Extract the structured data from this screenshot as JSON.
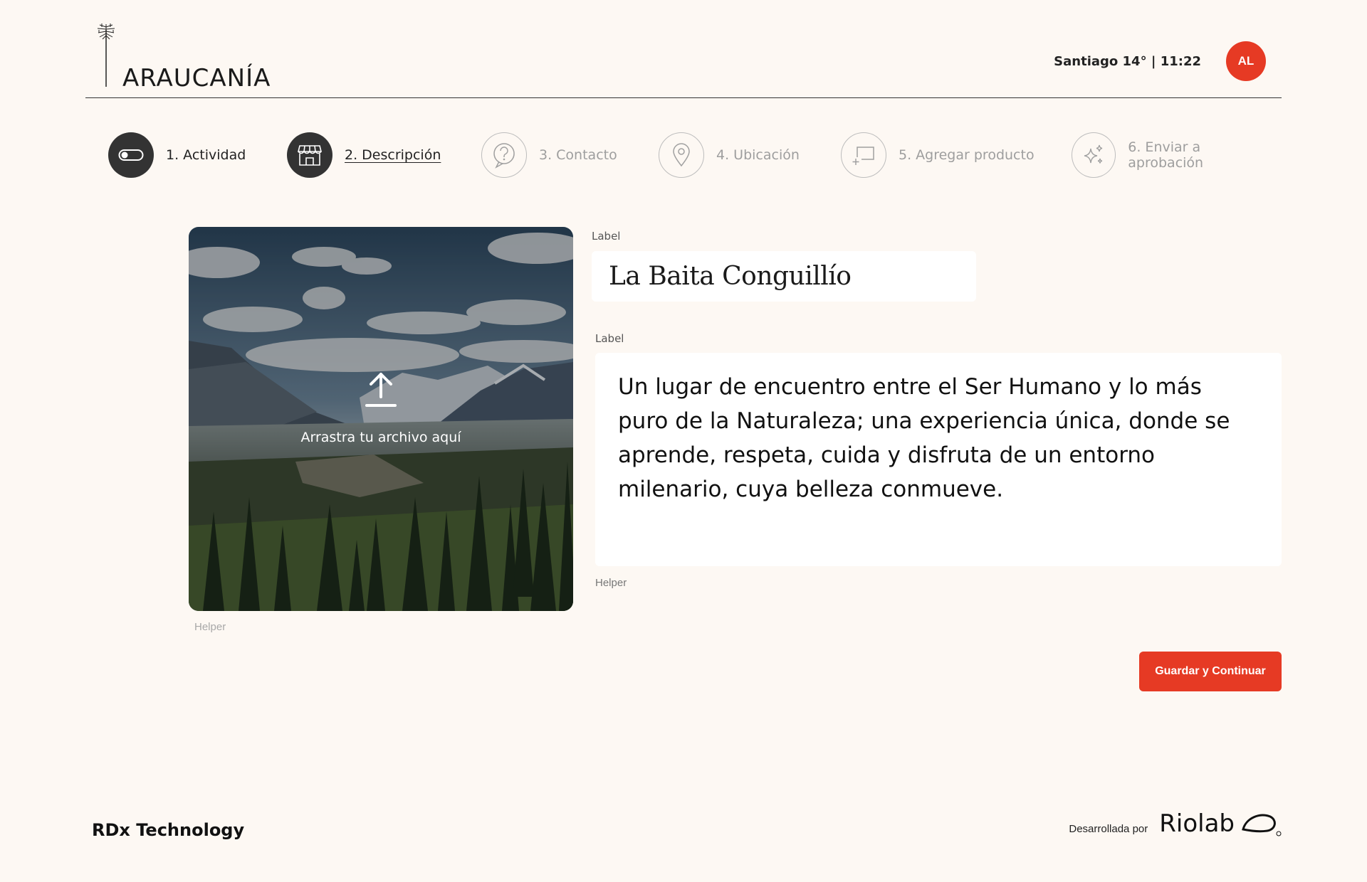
{
  "header": {
    "logo_text": "ARAUCANÍA",
    "weather": "Santiago 14° | 11:22",
    "avatar_initials": "AL"
  },
  "steps": [
    {
      "label": "1. Actividad",
      "state": "done",
      "icon": "toggle-icon"
    },
    {
      "label": "2. Descripción",
      "state": "active",
      "icon": "store-icon"
    },
    {
      "label": "3. Contacto",
      "state": "todo",
      "icon": "question-icon"
    },
    {
      "label": "4. Ubicación",
      "state": "todo",
      "icon": "location-pin-icon"
    },
    {
      "label": "5. Agregar producto",
      "state": "todo",
      "icon": "add-product-icon"
    },
    {
      "label": "6. Enviar a aprobación",
      "state": "todo",
      "icon": "sparkles-icon"
    }
  ],
  "upload": {
    "text": "Arrastra tu archivo aquí",
    "helper": "Helper",
    "icon": "upload-icon"
  },
  "title_field": {
    "label": "Label",
    "value": "La Baita Conguillío"
  },
  "description_field": {
    "label": "Label",
    "value": "Un lugar de encuentro entre el Ser Humano y lo más puro de la Naturaleza; una experiencia única, donde se aprende, respeta, cuida y disfruta de un entorno milenario, cuya belleza conmueve.",
    "helper": "Helper"
  },
  "actions": {
    "save_label": "Guardar y Continuar"
  },
  "footer": {
    "company": "RDx Technology",
    "developed_by": "Desarrollada por",
    "brand": "Riolab"
  },
  "colors": {
    "accent": "#e63a24",
    "background": "#fdf8f3",
    "dark": "#333333"
  }
}
